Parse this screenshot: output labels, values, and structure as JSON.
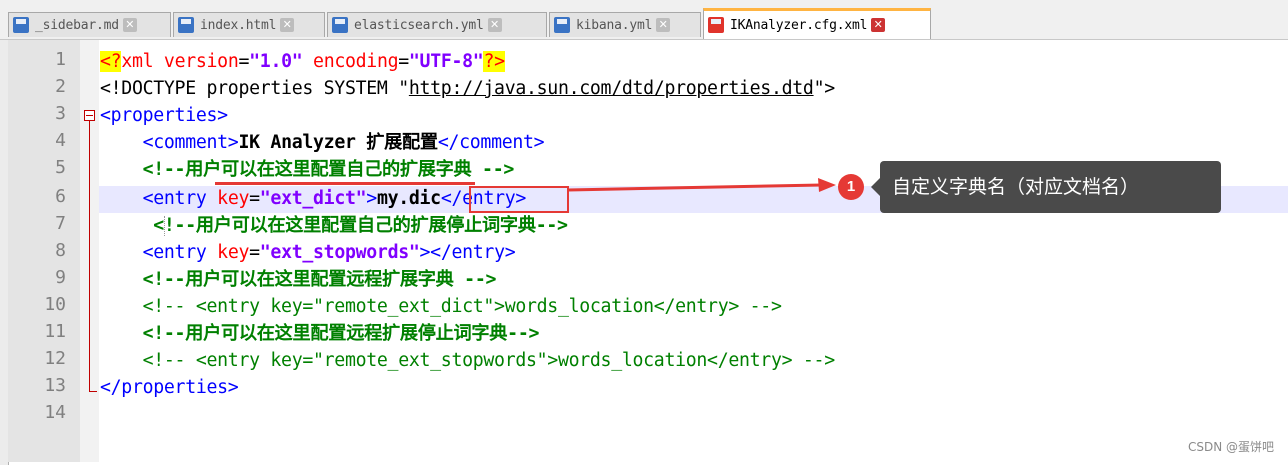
{
  "tabs": [
    {
      "label": "_sidebar.md",
      "active": false
    },
    {
      "label": "index.html",
      "active": false
    },
    {
      "label": "elasticsearch.yml",
      "active": false
    },
    {
      "label": "kibana.yml",
      "active": false
    },
    {
      "label": "IKAnalyzer.cfg.xml",
      "active": true
    }
  ],
  "tab_close_glyph": "✕",
  "line_numbers": [
    "1",
    "2",
    "3",
    "4",
    "5",
    "6",
    "7",
    "8",
    "9",
    "10",
    "11",
    "12",
    "13",
    "14"
  ],
  "code": {
    "l1": {
      "lt": "<",
      "q": "?",
      "xml": "xml",
      "sp1": " ",
      "version_attr": "version",
      "eq1": "=",
      "version_val": "\"1.0\"",
      "sp2": " ",
      "encoding_attr": "encoding",
      "eq2": "=",
      "encoding_val": "\"UTF-8\"",
      "q2": "?",
      "gt": ">"
    },
    "l2": {
      "open": "<!DOCTYPE properties SYSTEM \"",
      "url": "http://java.sun.com/dtd/properties.dtd",
      "close": "\">"
    },
    "l3": {
      "tag": "<properties>"
    },
    "l4": {
      "indent": "    ",
      "open": "<comment>",
      "text": "IK Analyzer 扩展配置",
      "close": "</comment>"
    },
    "l5": {
      "indent": "    ",
      "comment": "<!--用户可以在这里配置自己的扩展字典 -->"
    },
    "l6": {
      "indent": "    ",
      "open": "<entry ",
      "attr": "key",
      "eq": "=",
      "val": "\"ext_dict\"",
      "gt": ">",
      "text": "my.dic",
      "close": "</entry>"
    },
    "l7": {
      "indent": "     ",
      "comment": "<!--用户可以在这里配置自己的扩展停止词字典-->"
    },
    "l8": {
      "indent": "    ",
      "open": "<entry ",
      "attr": "key",
      "eq": "=",
      "val": "\"ext_stopwords\"",
      "close": "></entry>"
    },
    "l9": {
      "indent": "    ",
      "comment": "<!--用户可以在这里配置远程扩展字典 -->"
    },
    "l10": {
      "indent": "    ",
      "comment": "<!-- <entry key=\"remote_ext_dict\">words_location</entry> -->"
    },
    "l11": {
      "indent": "    ",
      "comment": "<!--用户可以在这里配置远程扩展停止词字典-->"
    },
    "l12": {
      "indent": "    ",
      "comment": "<!-- <entry key=\"remote_ext_stopwords\">words_location</entry> -->"
    },
    "l13": {
      "tag": "</properties>"
    }
  },
  "annotation": {
    "badge": "1",
    "tooltip": "自定义字典名（对应文档名）"
  },
  "watermark": "CSDN @蛋饼吧",
  "colors": {
    "tag": "#0000ff",
    "attr": "#ff0000",
    "value": "#8000ff",
    "comment": "#008000",
    "annotation": "#e53935",
    "active_tab_accent": "#ffb442"
  }
}
